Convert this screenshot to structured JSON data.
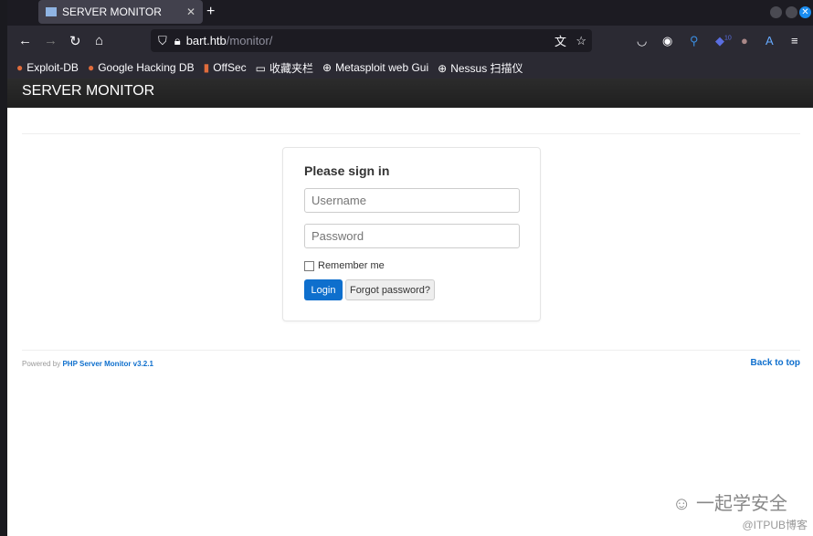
{
  "browser": {
    "tab_title": "SERVER MONITOR",
    "url_host": "bart.htb",
    "url_path": "/monitor/",
    "ext_badge": "10",
    "bookmarks": [
      "Exploit-DB",
      "Google Hacking DB",
      "OffSec",
      "收藏夹栏",
      "Metasploit web Gui",
      "Nessus 扫描仪"
    ]
  },
  "nav": {
    "brand": "SERVER MONITOR"
  },
  "login": {
    "title": "Please sign in",
    "username_placeholder": "Username",
    "password_placeholder": "Password",
    "remember": "Remember me",
    "login_button": "Login",
    "forgot_button": "Forgot password?"
  },
  "footer": {
    "powered_by": "Powered by ",
    "product": "PHP Server Monitor v3.2.1",
    "back_to_top": "Back to top"
  },
  "watermark": {
    "title": "一起学安全",
    "sub": "@ITPUB博客"
  }
}
